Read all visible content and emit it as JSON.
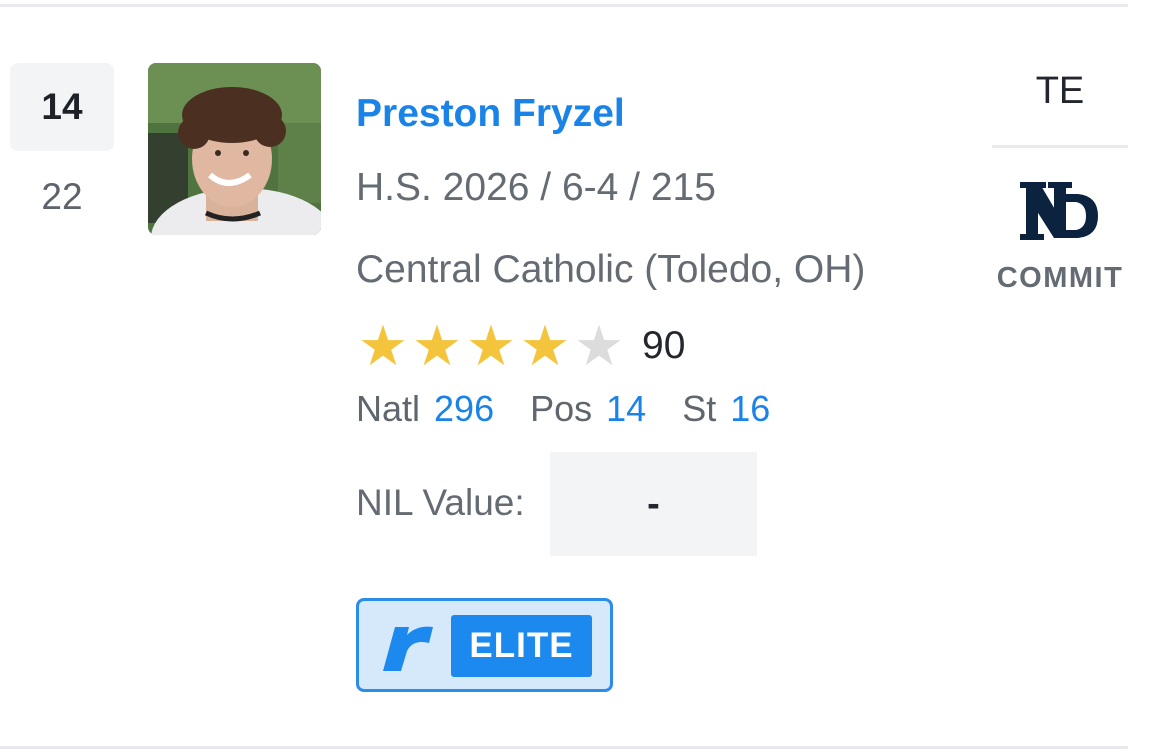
{
  "player": {
    "rank": "14",
    "previous_rank": "22",
    "name": "Preston Fryzel",
    "meta": "H.S. 2026 / 6-4 / 215",
    "school": "Central Catholic (Toledo, OH)",
    "star_rating": 4,
    "max_stars": 5,
    "rating": "90",
    "rankings": [
      {
        "label": "Natl",
        "value": "296"
      },
      {
        "label": "Pos",
        "value": "14"
      },
      {
        "label": "St",
        "value": "16"
      }
    ],
    "nil_label": "NIL Value:",
    "nil_value": "-",
    "badge": {
      "icon": "rivals-r-icon",
      "label": "ELITE"
    },
    "position": "TE",
    "team": {
      "logo": "notre-dame-logo",
      "status": "COMMIT"
    }
  },
  "colors": {
    "link": "#1a83e8",
    "star_on": "#f3c43c",
    "star_off": "#dcdcdc",
    "badge_bg": "#d5e9fb",
    "badge_tag": "#1c89ee",
    "team_navy": "#0c2340"
  }
}
